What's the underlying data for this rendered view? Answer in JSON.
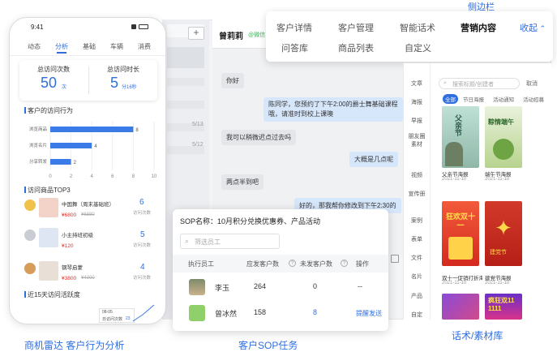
{
  "left_phone": {
    "time": "9:41",
    "tabs": [
      "动态",
      "分析",
      "基础",
      "车辆",
      "消费"
    ],
    "active_tab": 1,
    "stats": [
      {
        "label": "总访问次数",
        "value": "50",
        "unit": "次"
      },
      {
        "label": "总访问时长",
        "value": "5",
        "unit": "分16秒"
      }
    ],
    "behavior_title": "客户的访问行为",
    "behavior_chart": {
      "type": "bar",
      "categories": [
        "浏览商品",
        "浏览名片",
        "分享转发"
      ],
      "values": [
        8,
        4,
        2
      ],
      "xticks": [
        "0",
        "2",
        "4",
        "6",
        "8",
        "10"
      ],
      "xlim": [
        0,
        10
      ]
    },
    "top3_title": "访问商品TOP3",
    "products": [
      {
        "name": "中国舞（周末基础班）",
        "price": "¥6800",
        "orig": "¥6880",
        "count": "6",
        "unit": "访问次数"
      },
      {
        "name": "小主持班初级",
        "price": "¥120",
        "orig": "",
        "count": "5",
        "unit": "访问次数"
      },
      {
        "name": "钢琴启蒙",
        "price": "¥3800",
        "orig": "¥4000",
        "count": "4",
        "unit": "访问次数"
      }
    ],
    "trend_title": "近15天访问活跃度",
    "trend_tip": {
      "date": "08-05",
      "label": "日访问次数",
      "value": "23"
    }
  },
  "chat": {
    "contact": "曾莉莉",
    "wechat_tag": "@微信",
    "add_symbol": "+",
    "list_dates": [
      "5/13",
      "5/12"
    ],
    "messages": [
      {
        "side": "left",
        "text": "你好"
      },
      {
        "side": "right",
        "text": "陈同学，您预约了下午2:00的爵士舞基础课程",
        "text2": "哦，请准时到校上课噢"
      },
      {
        "side": "left",
        "text": "我可以稍微迟点过去吗"
      },
      {
        "side": "right",
        "text": "大概是几点呢"
      },
      {
        "side": "left",
        "text": "两点半到吧"
      },
      {
        "side": "right",
        "text": "好的，那我帮你修改到下午2:30的"
      }
    ]
  },
  "top_nav": {
    "row1": [
      "客户详情",
      "客户管理",
      "智能话术",
      "营销内容"
    ],
    "row2": [
      "问答库",
      "商品列表",
      "自定义"
    ],
    "active": "营销内容",
    "collapse": "收起",
    "caption": "侧边栏"
  },
  "material": {
    "categories": [
      "文章",
      "海报",
      "早报",
      "朋友圈素材",
      "视频",
      "宣传册",
      "案例",
      "表单",
      "文件",
      "名片",
      "产品",
      "自定"
    ],
    "search_placeholder": "搜索标题/创建者",
    "cancel": "取消",
    "filters": [
      "全部",
      "节日海报",
      "活动通知",
      "活动招募"
    ],
    "posters": [
      {
        "title": "父亲节海报",
        "date": "2021-11-10",
        "text": "父亲节"
      },
      {
        "title": "端午节海报",
        "date": "2021-11-10",
        "text": "粽情端午"
      },
      {
        "title": "双十一促销打折海报",
        "date": "2021-11-10",
        "text": "狂欢双十一"
      },
      {
        "title": "建党节海报",
        "date": "2021-11-10",
        "text": "建党节"
      },
      {
        "title": "",
        "date": "",
        "text": ""
      },
      {
        "title": "",
        "date": "",
        "text": "疯狂双11 1111"
      }
    ]
  },
  "sop": {
    "title": "SOP名称：10月积分兑换优惠券、产品活动",
    "search_placeholder": "筛选员工",
    "headers": [
      "执行员工",
      "应发客户数",
      "未发客户数",
      "操作"
    ],
    "rows": [
      {
        "name": "李玉",
        "total": "264",
        "unsent": "0",
        "action": "--"
      },
      {
        "name": "曾冰然",
        "total": "158",
        "unsent": "8",
        "action": "提醒发送"
      }
    ]
  },
  "captions": {
    "left": "商机雷达  客户行为分析",
    "middle": "客户SOP任务",
    "right": "话术/素材库"
  },
  "colors": {
    "accent": "#2f6fe0",
    "price": "#e0302a",
    "bar": "#3a7be8"
  }
}
